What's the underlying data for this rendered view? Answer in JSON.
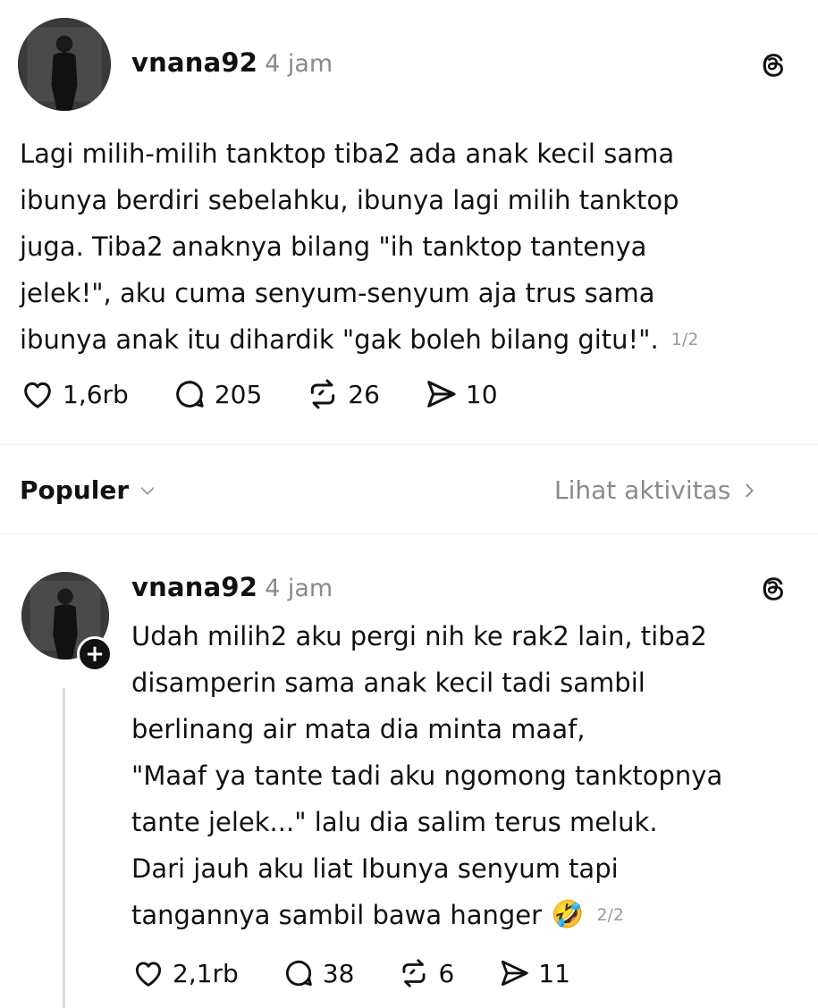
{
  "post1": {
    "username": "vnana92",
    "time": "4 jam",
    "lines": [
      "Lagi milih-milih tanktop tiba2 ada anak kecil sama",
      "ibunya berdiri sebelahku, ibunya lagi milih tanktop",
      "juga. Tiba2 anaknya bilang \"ih tanktop tantenya",
      "jelek!\", aku cuma senyum-senyum aja trus sama",
      "ibunya anak itu dihardik \"gak boleh bilang gitu!\"."
    ],
    "page_indicator": "1/2",
    "likes": "1,6rb",
    "comments": "205",
    "reposts": "26",
    "shares": "10"
  },
  "sort": {
    "label": "Populer",
    "activity_link": "Lihat aktivitas"
  },
  "post2": {
    "username": "vnana92",
    "time": "4 jam",
    "lines": [
      "Udah milih2 aku pergi nih ke rak2 lain, tiba2",
      "disamperin sama anak kecil tadi sambil",
      "berlinang air mata dia minta maaf,",
      "\"Maaf ya tante tadi aku ngomong tanktopnya",
      "tante jelek...\" lalu dia salim terus meluk.",
      "Dari jauh aku liat Ibunya senyum tapi",
      "tangannya sambil bawa hanger"
    ],
    "emoji": "🤣",
    "page_indicator": "2/2",
    "likes": "2,1rb",
    "comments": "38",
    "reposts": "6",
    "shares": "11"
  },
  "icons": {
    "like": "heart-icon",
    "comment": "comment-bubble-icon",
    "repost": "repost-icon",
    "share": "send-icon",
    "brand": "threads-logo-icon",
    "follow": "plus-icon",
    "sort_chevron": "chevron-down-icon",
    "activity_chevron": "chevron-right-icon"
  },
  "colors": {
    "text": "#111111",
    "muted": "#8a8a8a",
    "background": "#ffffff"
  }
}
